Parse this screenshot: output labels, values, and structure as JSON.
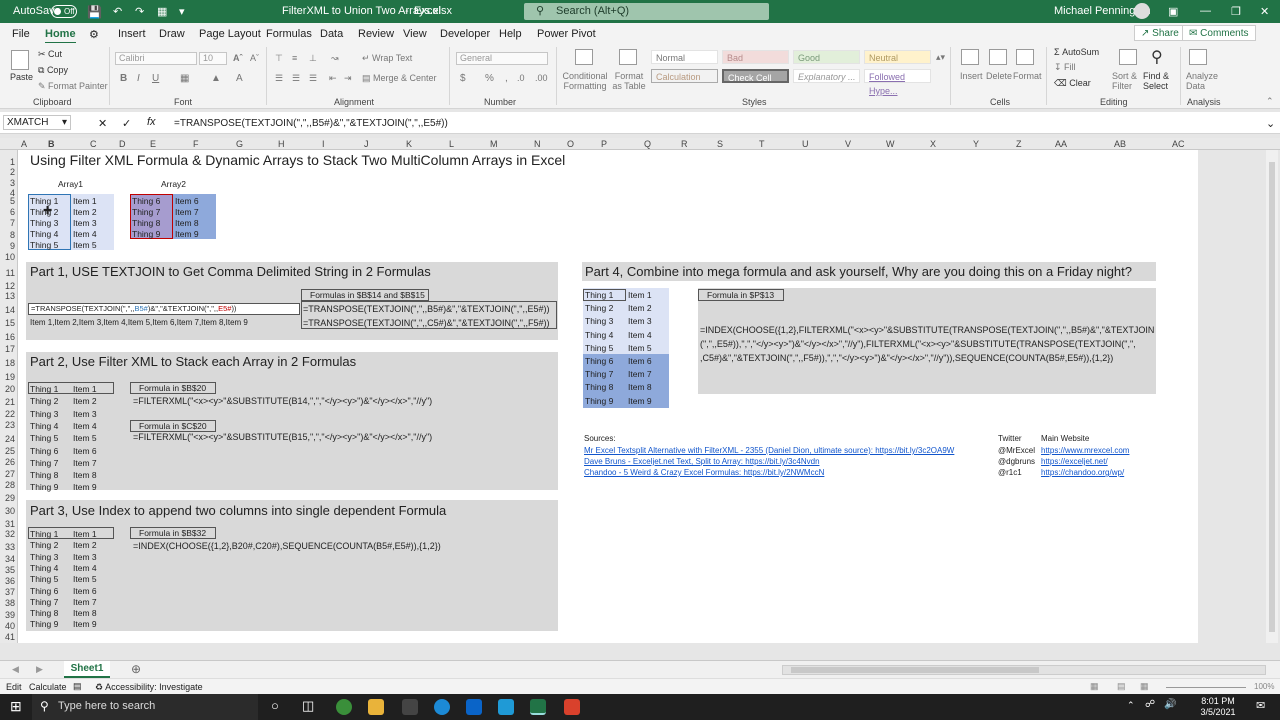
{
  "titlebar": {
    "autosave": "AutoSave",
    "autosave_state": "Off",
    "filename": "FilterXML to Union Two Arrays.xlsx",
    "app": "Excel",
    "search": "Search (Alt+Q)",
    "user": "Michael Pennington"
  },
  "tabs": [
    "File",
    "Home",
    "Insert",
    "Draw",
    "Page Layout",
    "Formulas",
    "Data",
    "Review",
    "View",
    "Developer",
    "Help",
    "Power Pivot"
  ],
  "share": "Share",
  "comments": "Comments",
  "ribbon": {
    "clipboard": {
      "paste": "Paste",
      "cut": "Cut",
      "copy": "Copy",
      "format_painter": "Format Painter",
      "label": "Clipboard"
    },
    "font": {
      "name": "Calibri",
      "size": "10",
      "label": "Font"
    },
    "alignment": {
      "wrap": "Wrap Text",
      "merge": "Merge & Center",
      "label": "Alignment"
    },
    "number": {
      "format": "General",
      "label": "Number"
    },
    "styles": {
      "cond": "Conditional Formatting",
      "table": "Format as Table",
      "normal": "Normal",
      "bad": "Bad",
      "good": "Good",
      "neutral": "Neutral",
      "calculation": "Calculation",
      "check": "Check Cell",
      "explanatory": "Explanatory ...",
      "followed": "Followed Hype...",
      "label": "Styles"
    },
    "cells": {
      "insert": "Insert",
      "delete": "Delete",
      "format": "Format",
      "label": "Cells"
    },
    "editing": {
      "autosum": "AutoSum",
      "fill": "Fill",
      "clear": "Clear",
      "sort": "Sort & Filter",
      "find": "Find & Select",
      "label": "Editing"
    },
    "analysis": {
      "analyze": "Analyze Data",
      "label": "Analysis"
    }
  },
  "formula_bar": {
    "name_box": "XMATCH",
    "formula": "=TRANSPOSE(TEXTJOIN(\",\",,B5#)&\",\"&TEXTJOIN(\",\",,E5#))"
  },
  "columns": [
    "A",
    "B",
    "C",
    "D",
    "E",
    "F",
    "G",
    "H",
    "I",
    "J",
    "K",
    "L",
    "M",
    "N",
    "O",
    "P",
    "Q",
    "R",
    "S",
    "T",
    "U",
    "V",
    "W",
    "X",
    "Y",
    "Z",
    "AA",
    "AB",
    "AC"
  ],
  "rows": [
    "1",
    "2",
    "3",
    "4",
    "5",
    "6",
    "7",
    "8",
    "9",
    "10",
    "11",
    "12",
    "13",
    "14",
    "15",
    "16",
    "17",
    "18",
    "19",
    "20",
    "21",
    "22",
    "23",
    "24",
    "25",
    "26",
    "27",
    "28",
    "29",
    "30",
    "31",
    "32",
    "33",
    "34",
    "35",
    "36",
    "37",
    "38",
    "39",
    "40",
    "41"
  ],
  "sheet": {
    "title": "Using Filter XML Formula & Dynamic Arrays to Stack Two MultiColumn Arrays in Excel",
    "array1_label": "Array1",
    "array2_label": "Array2",
    "array1": [
      [
        "Thing 1",
        "Item 1"
      ],
      [
        "Thing 2",
        "Item 2"
      ],
      [
        "Thing 3",
        "Item 3"
      ],
      [
        "Thing 4",
        "Item 4"
      ],
      [
        "Thing 5",
        "Item 5"
      ]
    ],
    "array2": [
      [
        "Thing 6",
        "Item 6"
      ],
      [
        "Thing 7",
        "Item 7"
      ],
      [
        "Thing 8",
        "Item 8"
      ],
      [
        "Thing 9",
        "Item 9"
      ]
    ],
    "part1": {
      "title": "Part 1, USE TEXTJOIN to Get Comma Delimited String in 2 Formulas",
      "formulas_label": "Formulas in $B$14 and $B$15",
      "editing": "=TRANSPOSE(TEXTJOIN(\",\",,B5#)&\",\"&TEXTJOIN(\",\",,E5#))",
      "edit_a": "=TRANSPOSE(TEXTJOIN(\",\",,",
      "edit_b": "B5#",
      "edit_c": ")&\",\"&TEXTJOIN(\",\",,",
      "edit_d": "E5#",
      "edit_e": "))",
      "result": "Item 1,Item 2,Item 3,Item 4,Item 5,Item 6,Item 7,Item 8,Item 9",
      "f14": "=TRANSPOSE(TEXTJOIN(\",\",,B5#)&\",\"&TEXTJOIN(\",\",,E5#))",
      "f15": "=TRANSPOSE(TEXTJOIN(\",\",,C5#)&\",\"&TEXTJOIN(\",\",,F5#))"
    },
    "stack": [
      [
        "Thing 1",
        "Item 1"
      ],
      [
        "Thing 2",
        "Item 2"
      ],
      [
        "Thing 3",
        "Item 3"
      ],
      [
        "Thing 4",
        "Item 4"
      ],
      [
        "Thing 5",
        "Item 5"
      ],
      [
        "Thing 6",
        "Item 6"
      ],
      [
        "Thing 7",
        "Item 7"
      ],
      [
        "Thing 8",
        "Item 8"
      ],
      [
        "Thing 9",
        "Item 9"
      ]
    ],
    "part2": {
      "title": "Part 2, Use Filter XML to Stack each Array in 2 Formulas",
      "label1": "Formula in $B$20",
      "f1": "=FILTERXML(\"<x><y>\"&SUBSTITUTE(B14,\",\",\"</y><y>\")&\"</y></x>\",\"//y\")",
      "label2": "Formula in $C$20",
      "f2": "=FILTERXML(\"<x><y>\"&SUBSTITUTE(B15,\",\",\"</y><y>\")&\"</y></x>\",\"//y\")"
    },
    "part3": {
      "title": "Part 3, Use Index to append two columns into single dependent Formula",
      "label": "Formula in $B$32",
      "f": "=INDEX(CHOOSE({1,2},B20#,C20#),SEQUENCE(COUNTA(B5#,E5#)),{1,2})"
    },
    "part4": {
      "title": "Part 4, Combine into mega formula and ask yourself, Why are you doing this on a Friday night?",
      "label": "Formula in $P$13",
      "f_line1": "=INDEX(CHOOSE({1,2},FILTERXML(\"<x><y>\"&SUBSTITUTE(TRANSPOSE(TEXTJOIN(\",\",,B5#)&\",\"&TEXTJOIN",
      "f_line2": "(\",\",,E5#)),\",\",\"</y><y>\")&\"</y></x>\",\"//y\"),FILTERXML(\"<x><y>\"&SUBSTITUTE(TRANSPOSE(TEXTJOIN(\",\",",
      "f_line3": ",C5#)&\",\"&TEXTJOIN(\",\",,F5#)),\",\",\"</y><y>\")&\"</y></x>\",\"//y\")),SEQUENCE(COUNTA(B5#,E5#)),{1,2})"
    },
    "sources": {
      "label": "Sources:",
      "twitter": "Twitter",
      "website": "Main Website",
      "items": [
        {
          "text": "Mr Excel Textsplit Alternative with FilterXML - 2355 (Daniel Dion, ultimate source): https://bit.ly/3c2OA9W",
          "handle": "@MrExcel",
          "site": "https://www.mrexcel.com"
        },
        {
          "text": "Dave Bruns - Exceljet.net Text, Split to Array: https://bit.ly/3c4Nvdn",
          "handle": "@dgbruns",
          "site": "https://exceljet.net/"
        },
        {
          "text": "Chandoo - 5 Weird & Crazy Excel Formulas: https://bit.ly/2NWMccN",
          "handle": "@r1c1",
          "site": "https://chandoo.org/wp/"
        }
      ]
    }
  },
  "sheet_tab": "Sheet1",
  "status": {
    "mode": "Edit",
    "calculate": "Calculate",
    "accessibility": "Accessibility: Investigate",
    "zoom": "100%"
  },
  "taskbar": {
    "search": "Type here to search",
    "time": "8:01 PM",
    "date": "3/5/2021"
  },
  "colors": {
    "excel_green": "#217346",
    "array_light": "#dce3f5",
    "array_dark": "#8ea9db",
    "panel": "#d9d9d9"
  }
}
